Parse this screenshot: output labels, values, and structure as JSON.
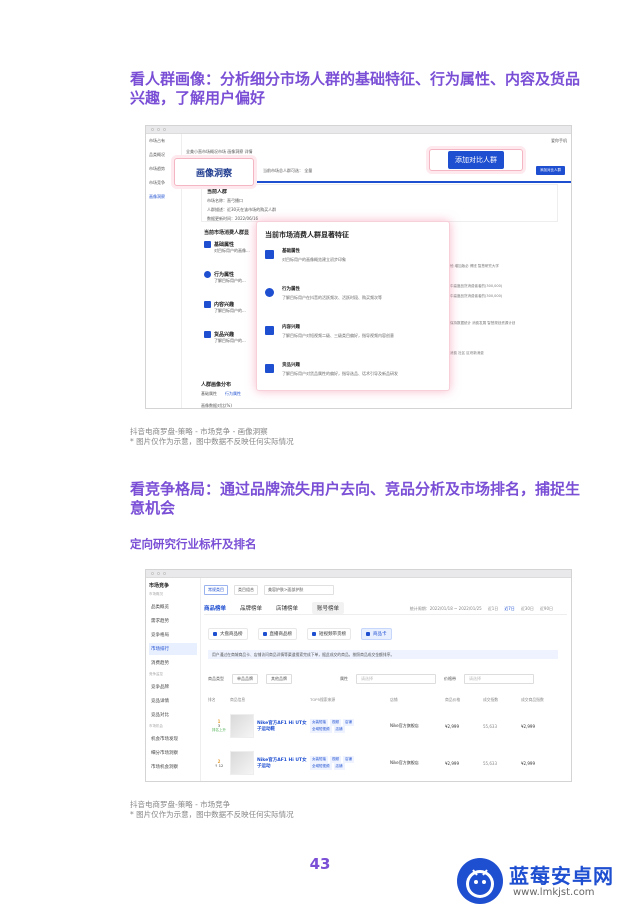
{
  "section1": {
    "heading": "看人群画像：分析细分市场人群的基础特征、行为属性、内容及货品兴趣，了解用户偏好",
    "caption_line1": "抖音电商罗盘-策略 - 市场竞争 - 画像洞察",
    "caption_line2": "* 图片仅作为示意，图中数据不反映任何实际情况"
  },
  "screenshot1": {
    "breadcrumb": "全美小直市场概况市场  画像洞察  详情",
    "top_right": "爱你手机",
    "sidebar": [
      "市场占有",
      "品类概况",
      "市场趋势",
      "市场竞争",
      "画像洞察"
    ],
    "persona_callout": "画像洞察",
    "add_compare_button": "添加对比人群",
    "small_add_button": "添加对比人群",
    "crowd_select": "当前市场总人群可选：  全量",
    "info_title": "当前人群",
    "info_lines": [
      "市场名称：直弓播口",
      "人群描述：近30天在该市场的购买人群",
      "数据更新时间：2022/06/16"
    ],
    "left_section_title": "当前市场消费人群显",
    "left_items": [
      {
        "name": "基础属性",
        "desc": "对目标用户的画像..."
      },
      {
        "name": "行为属性",
        "desc": "了解目标用户的..."
      },
      {
        "name": "内容兴趣",
        "desc": "了解目标用户的..."
      },
      {
        "name": "货品兴趣",
        "desc": "了解目标用户的..."
      }
    ],
    "popup_title": "当前市场消费人群显著特征",
    "popup_items": [
      {
        "name": "基础属性",
        "desc": "对目标用户的画像概览建立初步印象"
      },
      {
        "name": "行为属性",
        "desc": "了解目标用户在抖音的活跃频次、活跃时段、购买频次等"
      },
      {
        "name": "内容兴趣",
        "desc": "了解目标用户对短视频二级、三级类目偏好，指导视频内容创意"
      },
      {
        "name": "货品兴趣",
        "desc": "了解目标用户对货品属性的偏好，指导选品、话术引导及新品研发"
      }
    ],
    "right_col_lines": [
      "他  增加版必  博班  智慧研究大学",
      "中高度品货消费者者的(300,000)",
      "中高度品货消费者者的(300,000)",
      "保持数据统计 消费发展   智慧规划资源计划",
      "消费 社区  区块新消费"
    ],
    "bottom_title": "人群画像分布",
    "bottom_tabs": [
      "基础属性",
      "行为属性"
    ],
    "bottom_note": "画像数据对比(%)"
  },
  "section2": {
    "heading": "看竞争格局：通过品牌流失用户去向、竞品分析及市场排名，捕捉生意机会",
    "subheading": "定向研究行业标杆及排名",
    "caption_line1": "抖音电商罗盘-策略 - 市场竞争",
    "caption_line2": "* 图片仅作为示意，图中数据不反映任何实际情况"
  },
  "screenshot2": {
    "sidebar_title": "市场竞争",
    "sidebar_sections": [
      {
        "label": "市场概况",
        "items": [
          "品类概览",
          "需求趋势",
          "竞争格局",
          "市场排行",
          "消费趋势"
        ]
      },
      {
        "label": "竞争监控",
        "items": [
          "竞争品牌",
          "竞品详情",
          "竞品对比"
        ]
      },
      {
        "label": "市场机会",
        "items": [
          "机会市场发现",
          "细分市场洞察",
          "市场机会洞察"
        ]
      }
    ],
    "active_sidebar": "市场排行",
    "top_pills": [
      "常规类目",
      "类目组合"
    ],
    "category_select": "美容护肤>面部护肤",
    "rank_tabs": [
      "商品榜单",
      "品牌榜单",
      "店铺榜单",
      "账号榜单"
    ],
    "date_label": "统计周期：2022/01/18 ~ 2022/01/25",
    "date_options": [
      "近1日",
      "近7日",
      "近30日",
      "近90日"
    ],
    "channel_tabs": [
      "大盘商品榜",
      "直播商品榜",
      "短视频带货榜",
      "商品卡"
    ],
    "notice": "用户通过在商城商品卡、店铺访问商品详情等渠道搜索完成下单，据此成交的商品，按照商品成交金额排序。",
    "filters": {
      "type_label": "商品类型",
      "type_value": "单品品牌",
      "other": "其他品牌",
      "attr_label": "属性",
      "attr_placeholder": "请选择",
      "price_label": "价格带",
      "price_placeholder": "请选择"
    },
    "table_headers": [
      "排名",
      "商品信息",
      "TOP5搜索来源",
      "店铺",
      "商品价格",
      "成交指数",
      "成交商品指数"
    ],
    "rows": [
      {
        "rank": "1",
        "rank_sub": "3",
        "rank_note": "排名上升",
        "title": "Nike官方AF1 Hi UT女子运动鞋",
        "tags": [
          "女装短袖",
          "视频",
          "店铺",
          "全域短视频",
          "店铺"
        ],
        "shop": "Nike官方旗舰店",
        "price": "¥2,999",
        "index": "55,633",
        "amount": "¥2,999"
      },
      {
        "rank": "2",
        "rank_sub": "↑ 12",
        "rank_note": "",
        "title": "Nike官方AF1 Hi UT女子运动",
        "tags": [
          "女装短袖",
          "视频",
          "店铺",
          "全域短视频",
          "店铺"
        ],
        "shop": "Nike官方旗舰店",
        "price": "¥2,999",
        "index": "55,633",
        "amount": "¥2,999"
      }
    ]
  },
  "page_number": "43",
  "logo": {
    "brand": "蓝莓安卓网",
    "url": "www.lmkjst.com"
  },
  "colors": {
    "accent": "#7a4fd6",
    "blue": "#1f4fd1",
    "pink": "#f3b6c2"
  }
}
